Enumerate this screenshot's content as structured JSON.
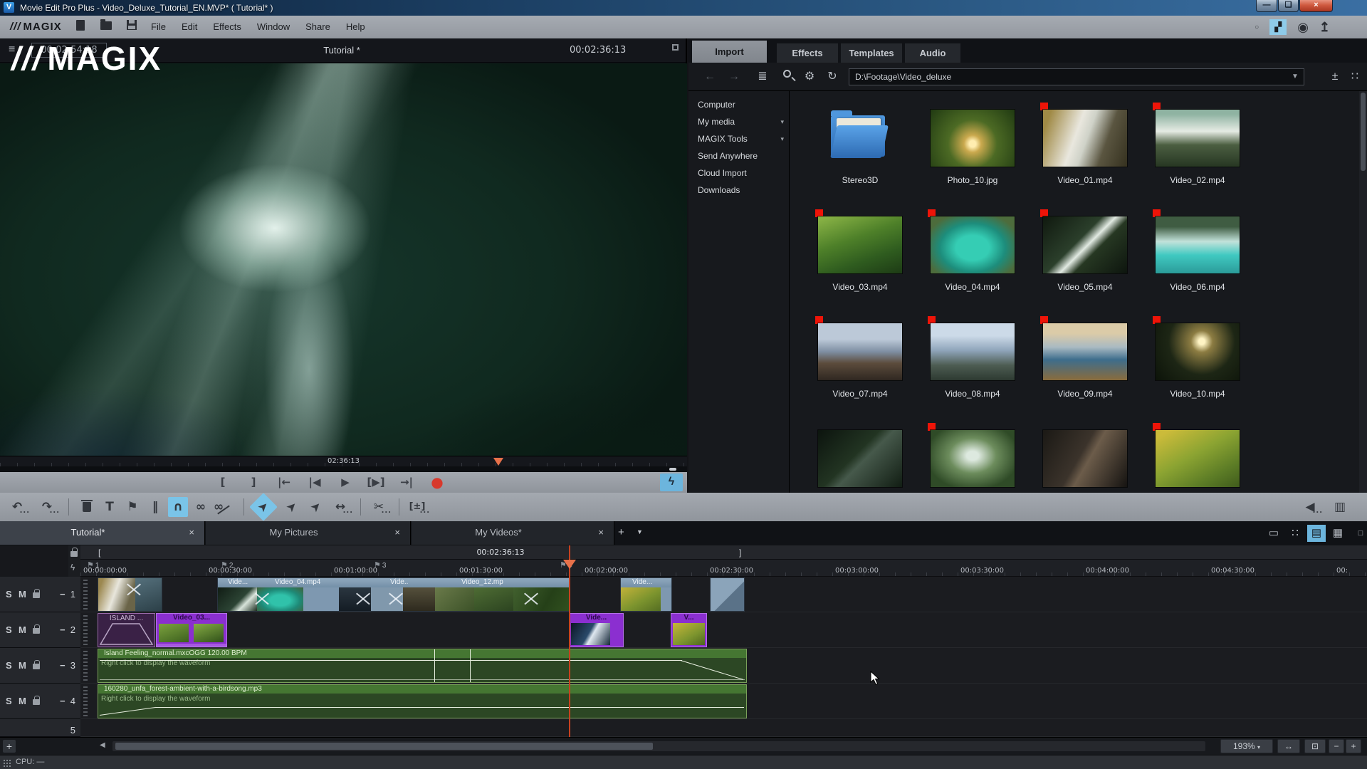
{
  "colors": {
    "accent_blue": "#7ac4e8",
    "record_red": "#d8392c",
    "used_marker_red": "#ee1408",
    "clip_purple": "#8b2fd0",
    "clip_green": "#2c4724",
    "playhead_orange": "#e8714a",
    "titlebar_blue": "#2b5984",
    "toolbar_gray": "#9aa0a7"
  },
  "window": {
    "title": "Movie Edit Pro Plus - Video_Deluxe_Tutorial_EN.MVP* ( Tutorial* )",
    "logo": "V",
    "min": "—",
    "max": "❑",
    "close": "×"
  },
  "menubar": {
    "brand_slashes": "///",
    "brand": "MAGIX",
    "menus": [
      "File",
      "Edit",
      "Effects",
      "Window",
      "Share",
      "Help"
    ]
  },
  "icons": {
    "chevron_down": "▾",
    "dropdown": "▼",
    "close": "×",
    "plus": "+",
    "minus": "−",
    "hamburger": "≡",
    "back": "←",
    "forward": "→",
    "refresh": "↻",
    "gear": "⚙",
    "circle": "○",
    "upload": "↥",
    "film": "▞",
    "disc": "◉",
    "tree": "≣",
    "plusminus": "±",
    "grid": "∷",
    "monitor": "▭",
    "storyboard": "∷",
    "listview": "▤",
    "multicam": "▦",
    "detach": "□",
    "speaker": "◀",
    "mixer": "▥",
    "bolt": "ϟ",
    "flag": "⚑",
    "fit": "⊡",
    "hstretch": "↔"
  },
  "preview": {
    "timecode_display": "00:02:54:18",
    "title": "Tutorial *",
    "timecode_right": "00:02:36:13",
    "watermark_slashes": "///",
    "watermark": "MAGIX",
    "seek_time": "02:36:13",
    "transport": [
      "[",
      "]",
      "|←",
      "|◀",
      "▶",
      "[▶]",
      "→|"
    ],
    "record": "●"
  },
  "mediapool": {
    "tabs": [
      "Import",
      "Effects",
      "Templates",
      "Audio"
    ],
    "path": "D:\\Footage\\Video_deluxe",
    "sidebar": [
      "Computer",
      "My media",
      "MAGIX Tools",
      "Send Anywhere",
      "Cloud Import",
      "Downloads"
    ],
    "items": [
      {
        "label": "Stereo3D",
        "marker": false,
        "style": ""
      },
      {
        "label": "Photo_10.jpg",
        "marker": false,
        "style": "background:radial-gradient(circle at 50% 60%,#ffedb0 6%,#caa94e 16%,#4c6a24 45%,#203a12)"
      },
      {
        "label": "Video_01.mp4",
        "marker": true,
        "style": "background:linear-gradient(110deg,#a08a46 8%,#e9e7de 40%,#cfd2c8 52%,#5a5540 72%,#35311f)"
      },
      {
        "label": "Video_02.mp4",
        "marker": true,
        "style": "background:linear-gradient(180deg,#8fb3a2 8%,#e6ebe4 38%,#4b5e41 62%,#273723)"
      },
      {
        "label": "Video_03.mp4",
        "marker": true,
        "style": "background:linear-gradient(160deg,#86b044 5%,#4e8029 40%,#2f5c1f 70%,#1d3b15)"
      },
      {
        "label": "Video_04.mp4",
        "marker": true,
        "style": "background:radial-gradient(ellipse at 50% 55%,#35cdb4 28%,#1d8d7c 55%,#4d6c3c 82%)"
      },
      {
        "label": "Video_05.mp4",
        "marker": true,
        "style": "background:linear-gradient(135deg,#10190f,#2b3f2b 42%,#e2eae3 52%,#263722 62%,#0d150e)"
      },
      {
        "label": "Video_06.mp4",
        "marker": true,
        "style": "background:linear-gradient(180deg,#3f5c42 18%,#c2e2da 44%,#40c9c1 68%,#2b9b99)"
      },
      {
        "label": "Video_07.mp4",
        "marker": true,
        "style": "background:linear-gradient(180deg,#bcc9d8 28%,#7e8ea2 50%,#5c4c3c 70%,#2f2721)"
      },
      {
        "label": "Video_08.mp4",
        "marker": true,
        "style": "background:linear-gradient(180deg,#ccdae8 22%,#8ea4ba 48%,#4d5c52 74%,#2d3a31)"
      },
      {
        "label": "Video_09.mp4",
        "marker": true,
        "style": "background:linear-gradient(180deg,#dbcba8 18%,#a9bac2 42%,#3e6d8c 64%,#8a6c3c)"
      },
      {
        "label": "Video_10.mp4",
        "marker": true,
        "style": "background:radial-gradient(circle at 55% 32%,#fff4c4 5%,#8c7c42 18%,#1d2615 55%,#0c1309)"
      },
      {
        "label": "",
        "marker": false,
        "style": "background:linear-gradient(135deg,#0c140e,#223422 44%,#46594b 54%,#111d13)"
      },
      {
        "label": "",
        "marker": true,
        "style": "background:radial-gradient(ellipse at 50% 45%,#dde9df 10%,#6c8c5c 40%,#2f4b27 78%)"
      },
      {
        "label": "",
        "marker": false,
        "style": "background:linear-gradient(120deg,#1b1915,#3b332b 44%,#6c5c4a 54%,#151311)"
      },
      {
        "label": "",
        "marker": true,
        "style": "background:linear-gradient(150deg,#cbbb3a 8%,#8ca432 44%,#5c7c26 76%,#405c1c)"
      }
    ]
  },
  "toolbar": {
    "undo": "↶",
    "redo": "↷",
    "text_tool": "T",
    "marker_tool": "⚑",
    "levels": "‖",
    "magnet": "∩",
    "group": "∞",
    "ungroup": "∞",
    "mouse": "➤",
    "obj_mouse": "➤",
    "range_mouse": "➤",
    "stretch": "↔",
    "split": "✂",
    "zoom_obj": "[±]"
  },
  "project_tabs": {
    "tabs": [
      "Tutorial*",
      "My Pictures",
      "My Videos*"
    ]
  },
  "timeline": {
    "cursor_time": "00:02:36:13",
    "range_open": "[",
    "range_close": "]",
    "ruler_labels": [
      "00:00:00:00",
      "00:00:30:00",
      "00:01:00:00",
      "00:01:30:00",
      "00:02:00:00",
      "00:02:30:00",
      "00:03:00:00",
      "00:03:30:00",
      "00:04:00:00",
      "00:04:30:00",
      "00:"
    ],
    "markers": [
      "1",
      "2",
      "3",
      "4"
    ],
    "solo": "S",
    "mute": "M",
    "track_nums": [
      "1",
      "2",
      "3",
      "4",
      "5"
    ],
    "clips": {
      "t1b_labels": [
        "Vide...",
        "Video_04.mp4",
        "Vide..",
        "Video_12.mp"
      ],
      "t1c_label": "Vide...",
      "t2a_label": "ISLAND ...",
      "t2b_label": "Video_03...",
      "t2c_label": "Vide...",
      "t2d_label": "V...",
      "a1_title": "Island Feeling_normal.mxcOGG  120.00 BPM",
      "a2_title": "160280_unfa_forest-ambient-with-a-birdsong.mp3",
      "wave_hint": "Right click to display the waveform"
    }
  },
  "bottombar": {
    "zoom_level": "193%"
  },
  "statusbar": {
    "cpu": "CPU: —"
  }
}
